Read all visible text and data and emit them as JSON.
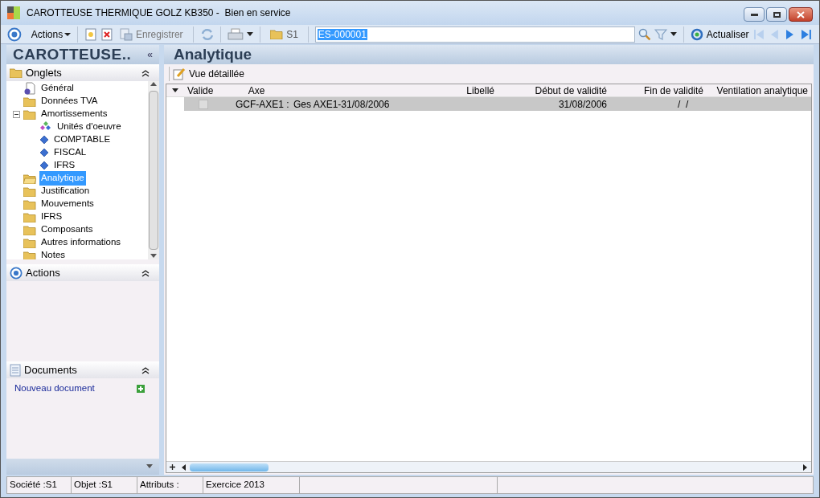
{
  "window": {
    "title": "CAROTTEUSE THERMIQUE GOLZ KB350 -  Bien en service"
  },
  "toolbar": {
    "actions": "Actions",
    "save": "Enregistrer",
    "folder": "S1",
    "record": "ES-000001",
    "refresh": "Actualiser"
  },
  "sidebar": {
    "title": "CAROTTEUSE..",
    "collapse": "«",
    "tabs_panel": {
      "title": "Onglets",
      "items": [
        {
          "label": "Général",
          "kind": "doc",
          "selected": false
        },
        {
          "label": "Données TVA",
          "kind": "folder",
          "selected": false
        },
        {
          "label": "Amortissements",
          "kind": "folder",
          "selected": false,
          "expanded": true,
          "children": [
            {
              "label": "Unités d'oeuvre",
              "kind": "multi",
              "selected": false
            },
            {
              "label": "COMPTABLE",
              "kind": "diamond",
              "selected": false
            },
            {
              "label": "FISCAL",
              "kind": "diamond",
              "selected": false
            },
            {
              "label": "IFRS",
              "kind": "diamond",
              "selected": false
            }
          ]
        },
        {
          "label": "Analytique",
          "kind": "folder",
          "selected": true
        },
        {
          "label": "Justification",
          "kind": "folder",
          "selected": false
        },
        {
          "label": "Mouvements",
          "kind": "folder",
          "selected": false
        },
        {
          "label": "IFRS",
          "kind": "folder",
          "selected": false
        },
        {
          "label": "Composants",
          "kind": "folder",
          "selected": false
        },
        {
          "label": "Autres informations",
          "kind": "folder",
          "selected": false
        },
        {
          "label": "Notes",
          "kind": "folder",
          "selected": false
        }
      ]
    },
    "actions_panel": {
      "title": "Actions"
    },
    "documents_panel": {
      "title": "Documents",
      "link": "Nouveau document"
    }
  },
  "main": {
    "title": "Analytique",
    "view_button": "Vue détaillée",
    "table": {
      "columns": [
        "Valide",
        "Axe",
        "Libellé",
        "Début de validité",
        "Fin de validité",
        "Ventilation analytique"
      ],
      "rows": [
        {
          "valide": false,
          "axe": "GCF-AXE1 :",
          "libelle": "Ges AXE1-31/08/2006",
          "debut": "31/08/2006",
          "fin": "/  /",
          "ventilation": "",
          "selected": true
        }
      ]
    }
  },
  "status_bar": [
    "Société :S1",
    "Objet :S1",
    "Attributs :",
    "Exercice 2013"
  ]
}
